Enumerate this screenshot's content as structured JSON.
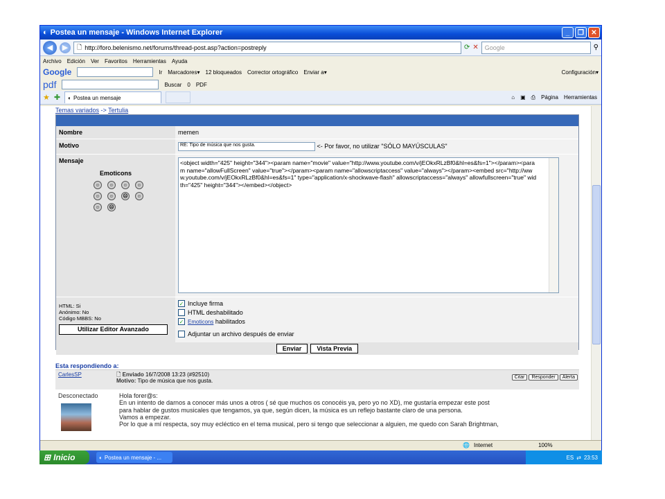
{
  "window": {
    "title": "Postea un mensaje - Windows Internet Explorer",
    "url": "http://foro.belenismo.net/forums/thread-post.asp?action=postreply",
    "search_placeholder": "Google"
  },
  "menu": [
    "Archivo",
    "Edición",
    "Ver",
    "Favoritos",
    "Herramientas",
    "Ayuda"
  ],
  "google_toolbar": {
    "logo": "Google",
    "go": "Ir",
    "bookmarks": "Marcadores▾",
    "blocked": "12 bloqueados",
    "spell": "Corrector ortográfico",
    "send": "Enviar a▾",
    "config": "Configuración▾"
  },
  "pdf_toolbar": {
    "logo": "pdf",
    "search": "Buscar",
    "count": "0",
    "pdf": "PDF"
  },
  "tab": {
    "label": "Postea un mensaje",
    "page_menu": "Página",
    "tools_menu": "Herramientas"
  },
  "breadcrumb": {
    "a": "Temas variados",
    "sep": "->",
    "b": "Tertulia"
  },
  "form": {
    "nombre_label": "Nombre",
    "nombre_value": "memen",
    "motivo_label": "Motivo",
    "motivo_value": "RE: Tipo de música que nos gusta.",
    "motivo_hint": "<- Por favor, no utilizar \"SÓLO MAYÚSCULAS\"",
    "mensaje_label": "Mensaje",
    "emoticons_title": "Emoticons",
    "mensaje_value": "<object width=\"425\" height=\"344\"><param name=\"movie\" value=\"http://www.youtube.com/v/jEOkxRLzBf0&hl=es&fs=1\"></param><param name=\"allowFullScreen\" value=\"true\"></param><param name=\"allowscriptaccess\" value=\"always\"></param><embed src=\"http://www.youtube.com/v/jEOkxRLzBf0&hl=es&fs=1\" type=\"application/x-shockwave-flash\" allowscriptaccess=\"always\" allowfullscreen=\"true\" width=\"425\" height=\"344\"></embed></object>",
    "html_status": "HTML: Si",
    "anon_status": "Anónimo: No",
    "mbbs_status": "Código MBBS: No",
    "advanced_button": "Utilizar Editor Avanzado",
    "opt_signature": "Incluye firma",
    "opt_html": "HTML deshabilitado",
    "opt_emoticons_link": "Emoticons",
    "opt_emoticons": "habilitados",
    "opt_attach": "Adjuntar un archivo después de enviar",
    "send_button": "Enviar",
    "preview_button": "Vista Previa"
  },
  "reply": {
    "title": "Esta respondiendo a:",
    "author": "CarlesSP",
    "posted_label": "Enviado",
    "posted_date": "16/7/2008 13:23 (#92510)",
    "motivo_label": "Motivo:",
    "motivo_value": "Tipo de música que nos gusta.",
    "status": "Desconectado",
    "quote_btn": "Citar",
    "reply_btn": "Responder",
    "alert_btn": "Alerta",
    "body": [
      "Hola forer@s:",
      "En un intento de darnos a conocer más unos a otros ( sé que muchos os conocéis ya, pero yo no XD), me gustaría empezar este post",
      "para hablar de gustos musicales que tengamos, ya que, según dicen, la música es un reflejo bastante claro de una persona.",
      "Vamos a empezar.",
      "Por lo que a mí respecta, soy muy ecléctico en el tema musical, pero si tengo que seleccionar a alguien, me quedo con Sarah Brightman,"
    ]
  },
  "statusbar": {
    "zone": "Internet",
    "zoom": "100%"
  },
  "taskbar": {
    "start": "Inicio",
    "task": "Postea un mensaje - ...",
    "lang": "ES",
    "time": "23:53"
  }
}
